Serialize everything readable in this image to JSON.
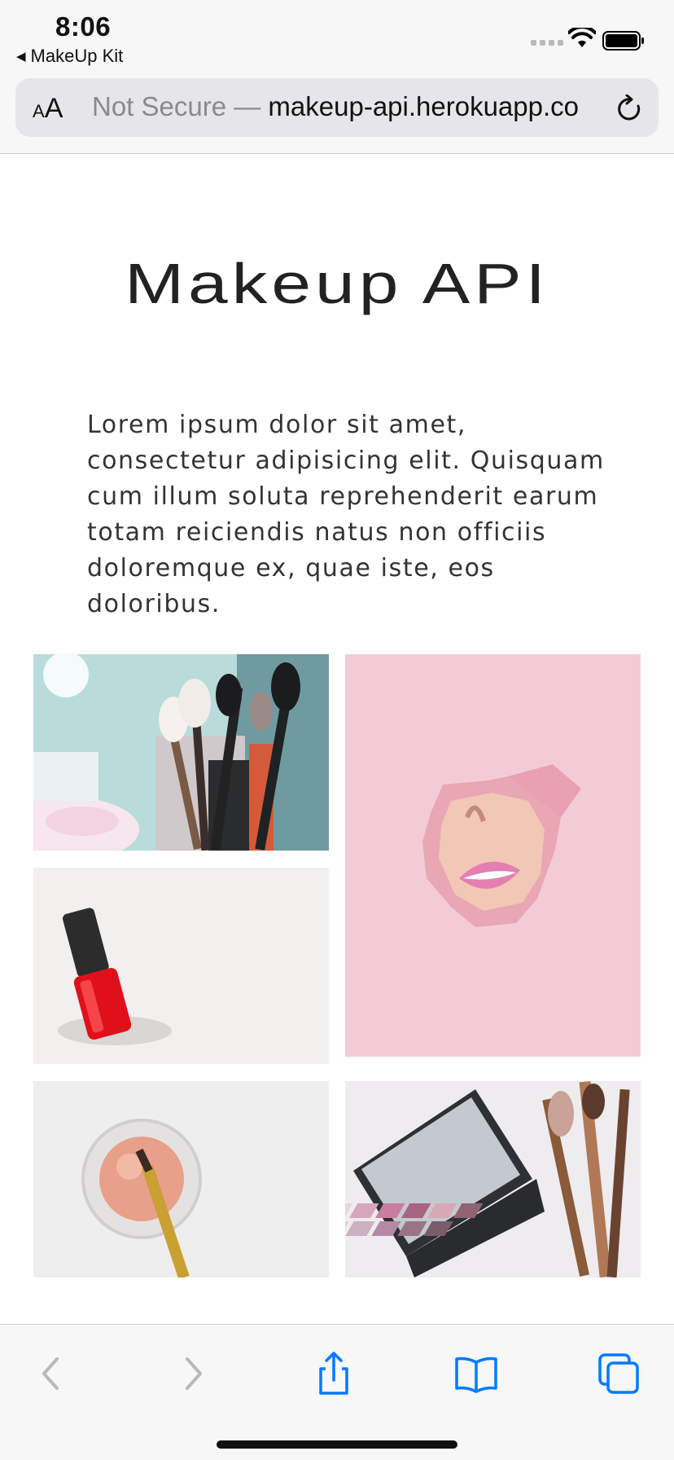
{
  "status": {
    "time": "8:06",
    "back_app": "MakeUp Kit"
  },
  "browser": {
    "text_size_label": "AA",
    "url_security": "Not Secure —",
    "url_host": "makeup-api.herokuapp.co"
  },
  "page": {
    "title": "Makeup API",
    "intro": "Lorem ipsum dolor sit amet, consectetur adipisicing elit. Quisquam cum illum soluta reprehenderit earum totam reiciendis natus non officiis doloremque ex, quae iste, eos doloribus."
  },
  "gallery": [
    {
      "icon": "makeup-brushes-photo"
    },
    {
      "icon": "lips-through-paper-photo"
    },
    {
      "icon": "nail-polish-photo"
    },
    {
      "icon": "powder-brush-photo"
    },
    {
      "icon": "eyeshadow-palette-photo"
    }
  ],
  "colors": {
    "accent": "#007aff",
    "disabled": "#b8b8bd",
    "pink_bg": "#f2cbd6"
  }
}
